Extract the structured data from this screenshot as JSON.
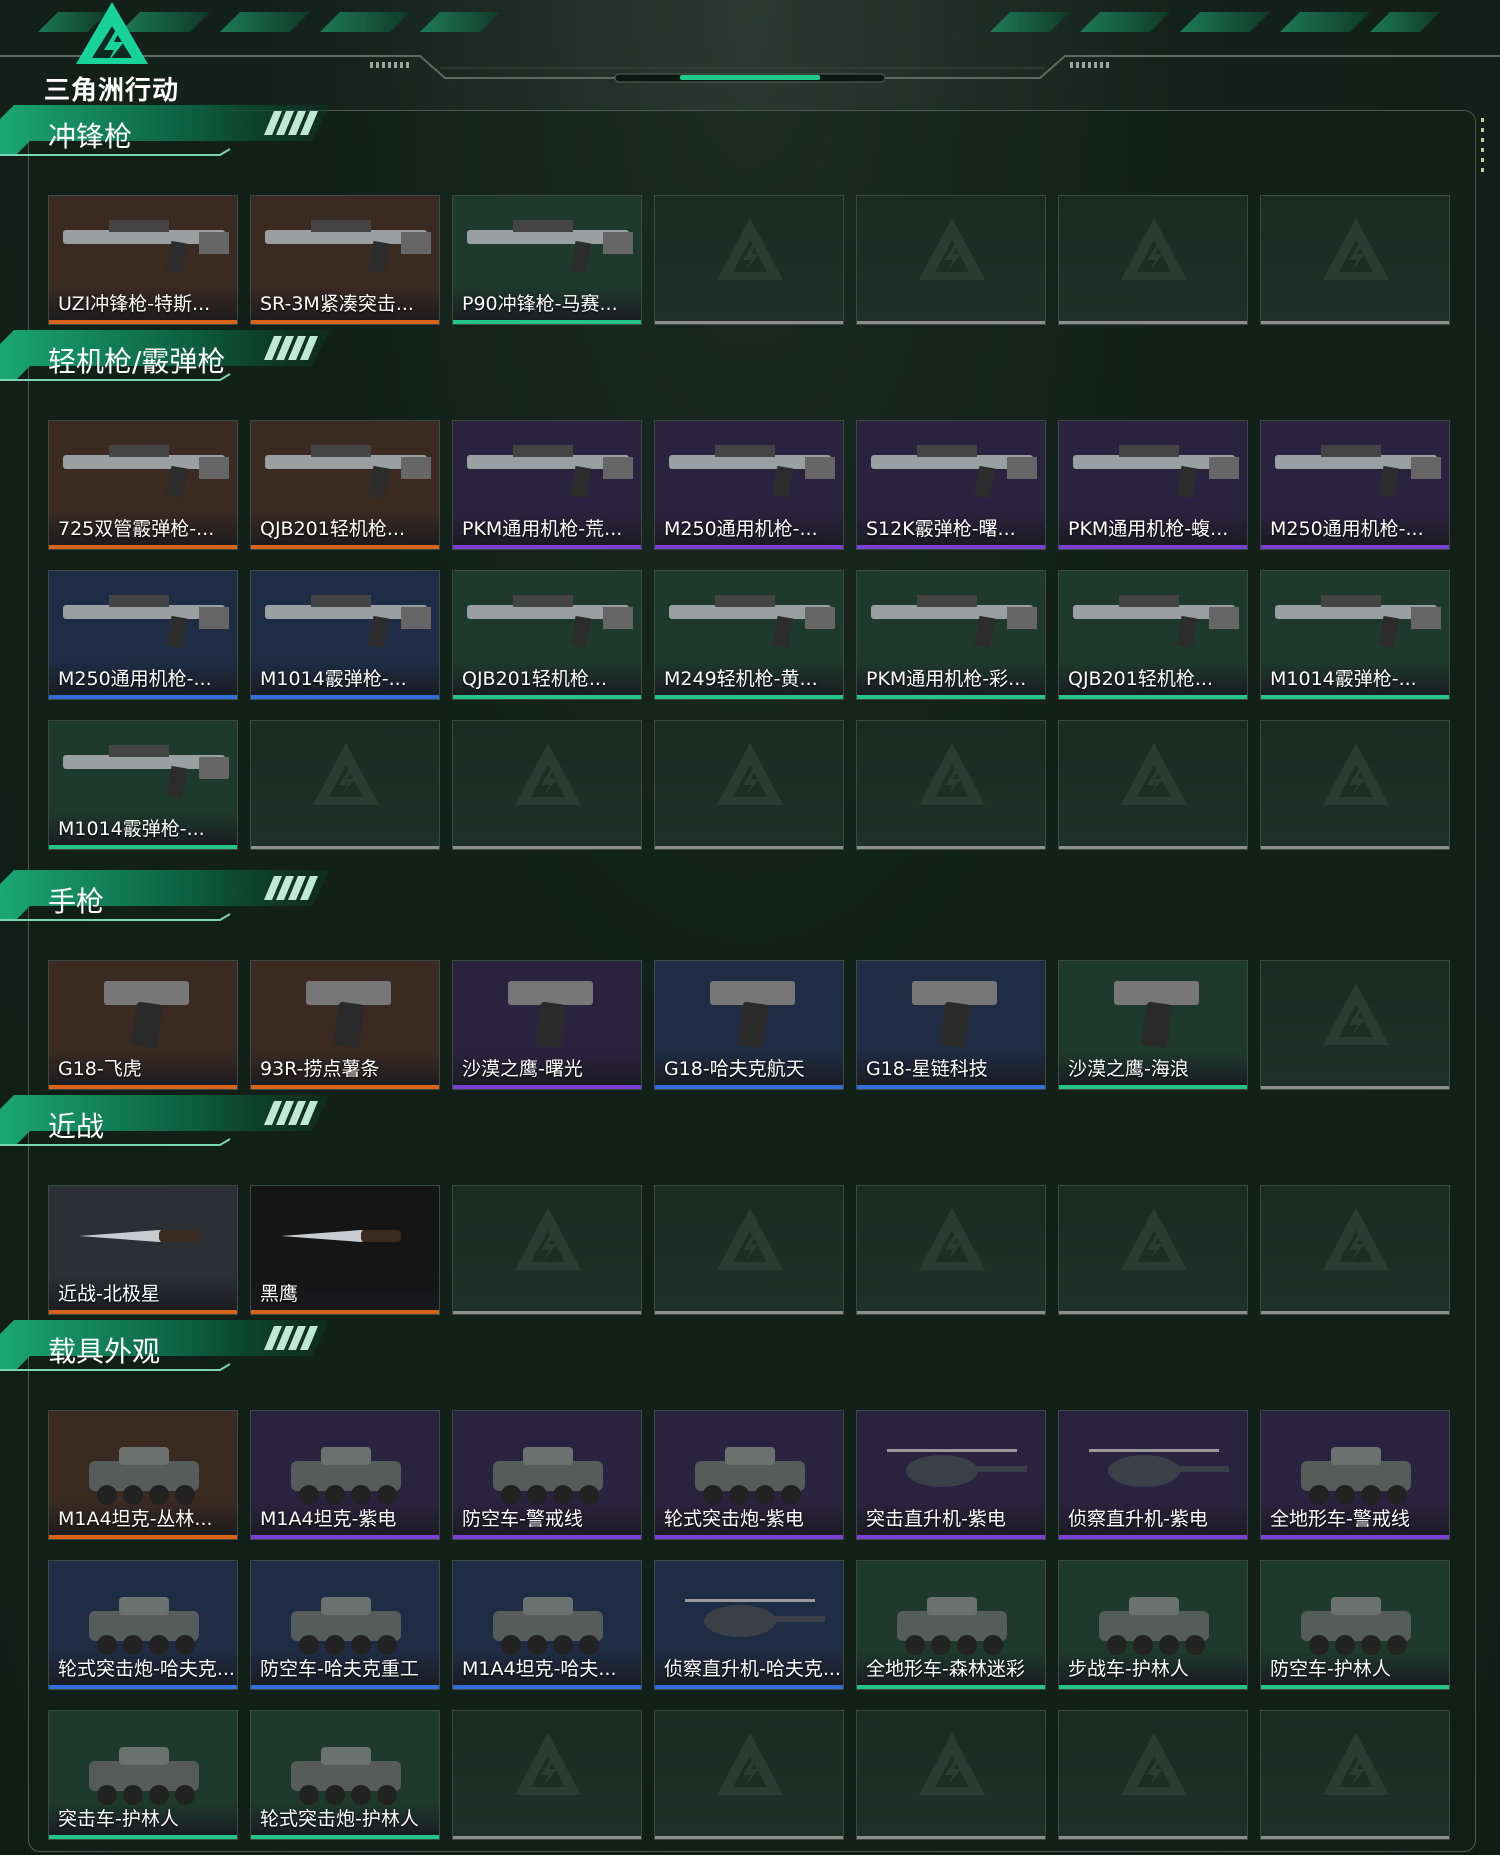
{
  "brand": {
    "title": "三角洲行动",
    "accent": "#16c98d"
  },
  "colors": {
    "orange": "#d8641c",
    "purple": "#7a3fd3",
    "blue": "#2f6fd6",
    "green": "#25c488",
    "gray": "#8d8f8e"
  },
  "sections": [
    {
      "title": "冲锋枪",
      "items": [
        {
          "label": "UZI冲锋枪-特斯...",
          "rarity": "orange",
          "bg": "#3a2a22"
        },
        {
          "label": "SR-3M紧凑突击...",
          "rarity": "orange",
          "bg": "#3a2a22"
        },
        {
          "label": "P90冲锋枪-马赛...",
          "rarity": "green",
          "bg": "#1e3a2e"
        },
        {
          "label": "",
          "rarity": "gray",
          "bg": ""
        },
        {
          "label": "",
          "rarity": "gray",
          "bg": ""
        },
        {
          "label": "",
          "rarity": "gray",
          "bg": ""
        },
        {
          "label": "",
          "rarity": "gray",
          "bg": ""
        }
      ]
    },
    {
      "title": "轻机枪/霰弹枪",
      "items": [
        {
          "label": "725双管霰弹枪-...",
          "rarity": "orange",
          "bg": "#3a2a22"
        },
        {
          "label": "QJB201轻机枪...",
          "rarity": "orange",
          "bg": "#3a2a22"
        },
        {
          "label": "PKM通用机枪-荒...",
          "rarity": "purple",
          "bg": "#2a2340"
        },
        {
          "label": "M250通用机枪-...",
          "rarity": "purple",
          "bg": "#2a2340"
        },
        {
          "label": "S12K霰弹枪-曙...",
          "rarity": "purple",
          "bg": "#2a2340"
        },
        {
          "label": "PKM通用机枪-蝮...",
          "rarity": "purple",
          "bg": "#2a2340"
        },
        {
          "label": "M250通用机枪-...",
          "rarity": "purple",
          "bg": "#2a2340"
        },
        {
          "label": "M250通用机枪-...",
          "rarity": "blue",
          "bg": "#1f2c45"
        },
        {
          "label": "M1014霰弹枪-...",
          "rarity": "blue",
          "bg": "#1f2c45"
        },
        {
          "label": "QJB201轻机枪...",
          "rarity": "green",
          "bg": "#1e3a2e"
        },
        {
          "label": "M249轻机枪-黄...",
          "rarity": "green",
          "bg": "#1e3a2e"
        },
        {
          "label": "PKM通用机枪-彩...",
          "rarity": "green",
          "bg": "#1e3a2e"
        },
        {
          "label": "QJB201轻机枪...",
          "rarity": "green",
          "bg": "#1e3a2e"
        },
        {
          "label": "M1014霰弹枪-...",
          "rarity": "green",
          "bg": "#1e3a2e"
        },
        {
          "label": "M1014霰弹枪-...",
          "rarity": "green",
          "bg": "#1e3a2e"
        },
        {
          "label": "",
          "rarity": "gray",
          "bg": ""
        },
        {
          "label": "",
          "rarity": "gray",
          "bg": ""
        },
        {
          "label": "",
          "rarity": "gray",
          "bg": ""
        },
        {
          "label": "",
          "rarity": "gray",
          "bg": ""
        },
        {
          "label": "",
          "rarity": "gray",
          "bg": ""
        },
        {
          "label": "",
          "rarity": "gray",
          "bg": ""
        }
      ]
    },
    {
      "title": "手枪",
      "items": [
        {
          "label": "G18-飞虎",
          "rarity": "orange",
          "bg": "#3a2a22"
        },
        {
          "label": "93R-捞点薯条",
          "rarity": "orange",
          "bg": "#3a2a22"
        },
        {
          "label": "沙漠之鹰-曙光",
          "rarity": "purple",
          "bg": "#2a2340"
        },
        {
          "label": "G18-哈夫克航天",
          "rarity": "blue",
          "bg": "#1f2c45"
        },
        {
          "label": "G18-星链科技",
          "rarity": "blue",
          "bg": "#1f2c45"
        },
        {
          "label": "沙漠之鹰-海浪",
          "rarity": "green",
          "bg": "#1e3a2e"
        },
        {
          "label": "",
          "rarity": "gray",
          "bg": ""
        }
      ]
    },
    {
      "title": "近战",
      "items": [
        {
          "label": "近战-北极星",
          "rarity": "orange",
          "bg": "#2b3034"
        },
        {
          "label": "黑鹰",
          "rarity": "orange",
          "bg": "#151515"
        },
        {
          "label": "",
          "rarity": "gray",
          "bg": ""
        },
        {
          "label": "",
          "rarity": "gray",
          "bg": ""
        },
        {
          "label": "",
          "rarity": "gray",
          "bg": ""
        },
        {
          "label": "",
          "rarity": "gray",
          "bg": ""
        },
        {
          "label": "",
          "rarity": "gray",
          "bg": ""
        }
      ]
    },
    {
      "title": "载具外观",
      "items": [
        {
          "label": "M1A4坦克-丛林...",
          "rarity": "orange",
          "bg": "#3a2a22"
        },
        {
          "label": "M1A4坦克-紫电",
          "rarity": "purple",
          "bg": "#2a2340"
        },
        {
          "label": "防空车-警戒线",
          "rarity": "purple",
          "bg": "#2a2340"
        },
        {
          "label": "轮式突击炮-紫电",
          "rarity": "purple",
          "bg": "#2a2340"
        },
        {
          "label": "突击直升机-紫电",
          "rarity": "purple",
          "bg": "#2a2340"
        },
        {
          "label": "侦察直升机-紫电",
          "rarity": "purple",
          "bg": "#2a2340"
        },
        {
          "label": "全地形车-警戒线",
          "rarity": "purple",
          "bg": "#2a2340"
        },
        {
          "label": "轮式突击炮-哈夫克...",
          "rarity": "blue",
          "bg": "#1f2c45"
        },
        {
          "label": "防空车-哈夫克重工",
          "rarity": "blue",
          "bg": "#1f2c45"
        },
        {
          "label": "M1A4坦克-哈夫...",
          "rarity": "blue",
          "bg": "#1f2c45"
        },
        {
          "label": "侦察直升机-哈夫克...",
          "rarity": "blue",
          "bg": "#1f2c45"
        },
        {
          "label": "全地形车-森林迷彩",
          "rarity": "green",
          "bg": "#1e3a2e"
        },
        {
          "label": "步战车-护林人",
          "rarity": "green",
          "bg": "#1e3a2e"
        },
        {
          "label": "防空车-护林人",
          "rarity": "green",
          "bg": "#1e3a2e"
        },
        {
          "label": "突击车-护林人",
          "rarity": "green",
          "bg": "#1e3a2e"
        },
        {
          "label": "轮式突击炮-护林人",
          "rarity": "green",
          "bg": "#1e3a2e"
        },
        {
          "label": "",
          "rarity": "gray",
          "bg": ""
        },
        {
          "label": "",
          "rarity": "gray",
          "bg": ""
        },
        {
          "label": "",
          "rarity": "gray",
          "bg": ""
        },
        {
          "label": "",
          "rarity": "gray",
          "bg": ""
        },
        {
          "label": "",
          "rarity": "gray",
          "bg": ""
        }
      ]
    }
  ]
}
